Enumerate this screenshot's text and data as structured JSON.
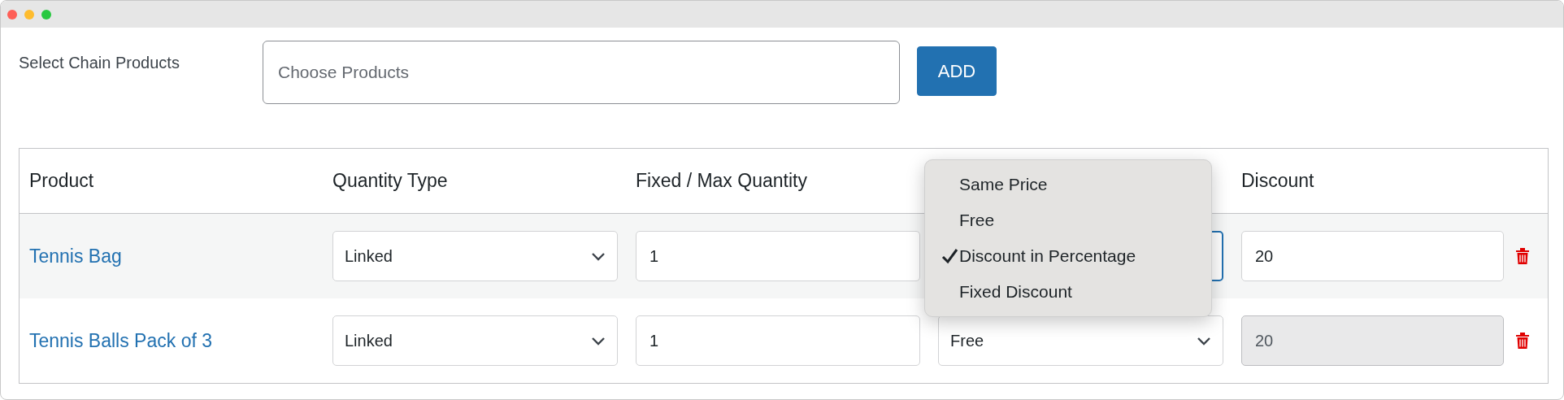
{
  "chain_products": {
    "label": "Select Chain Products",
    "placeholder": "Choose Products",
    "add_button": "ADD"
  },
  "table": {
    "columns": [
      "Product",
      "Quantity Type",
      "Fixed / Max Quantity",
      null,
      "Discount"
    ],
    "rows": [
      {
        "product": "Tennis Bag",
        "quantity_type": "Linked",
        "quantity": "1",
        "discount_focused": true,
        "discount": "20",
        "discount_disabled": false,
        "discount_menu": {
          "items": [
            {
              "label": "Same Price",
              "selected": false
            },
            {
              "label": "Free",
              "selected": false
            },
            {
              "label": "Discount in Percentage",
              "selected": true
            },
            {
              "label": "Fixed Discount",
              "selected": false
            }
          ]
        }
      },
      {
        "product": "Tennis Balls Pack of 3",
        "quantity_type": "Linked",
        "quantity": "1",
        "discount_type": "Free",
        "discount_focused": false,
        "discount": "20",
        "discount_disabled": true
      }
    ]
  }
}
